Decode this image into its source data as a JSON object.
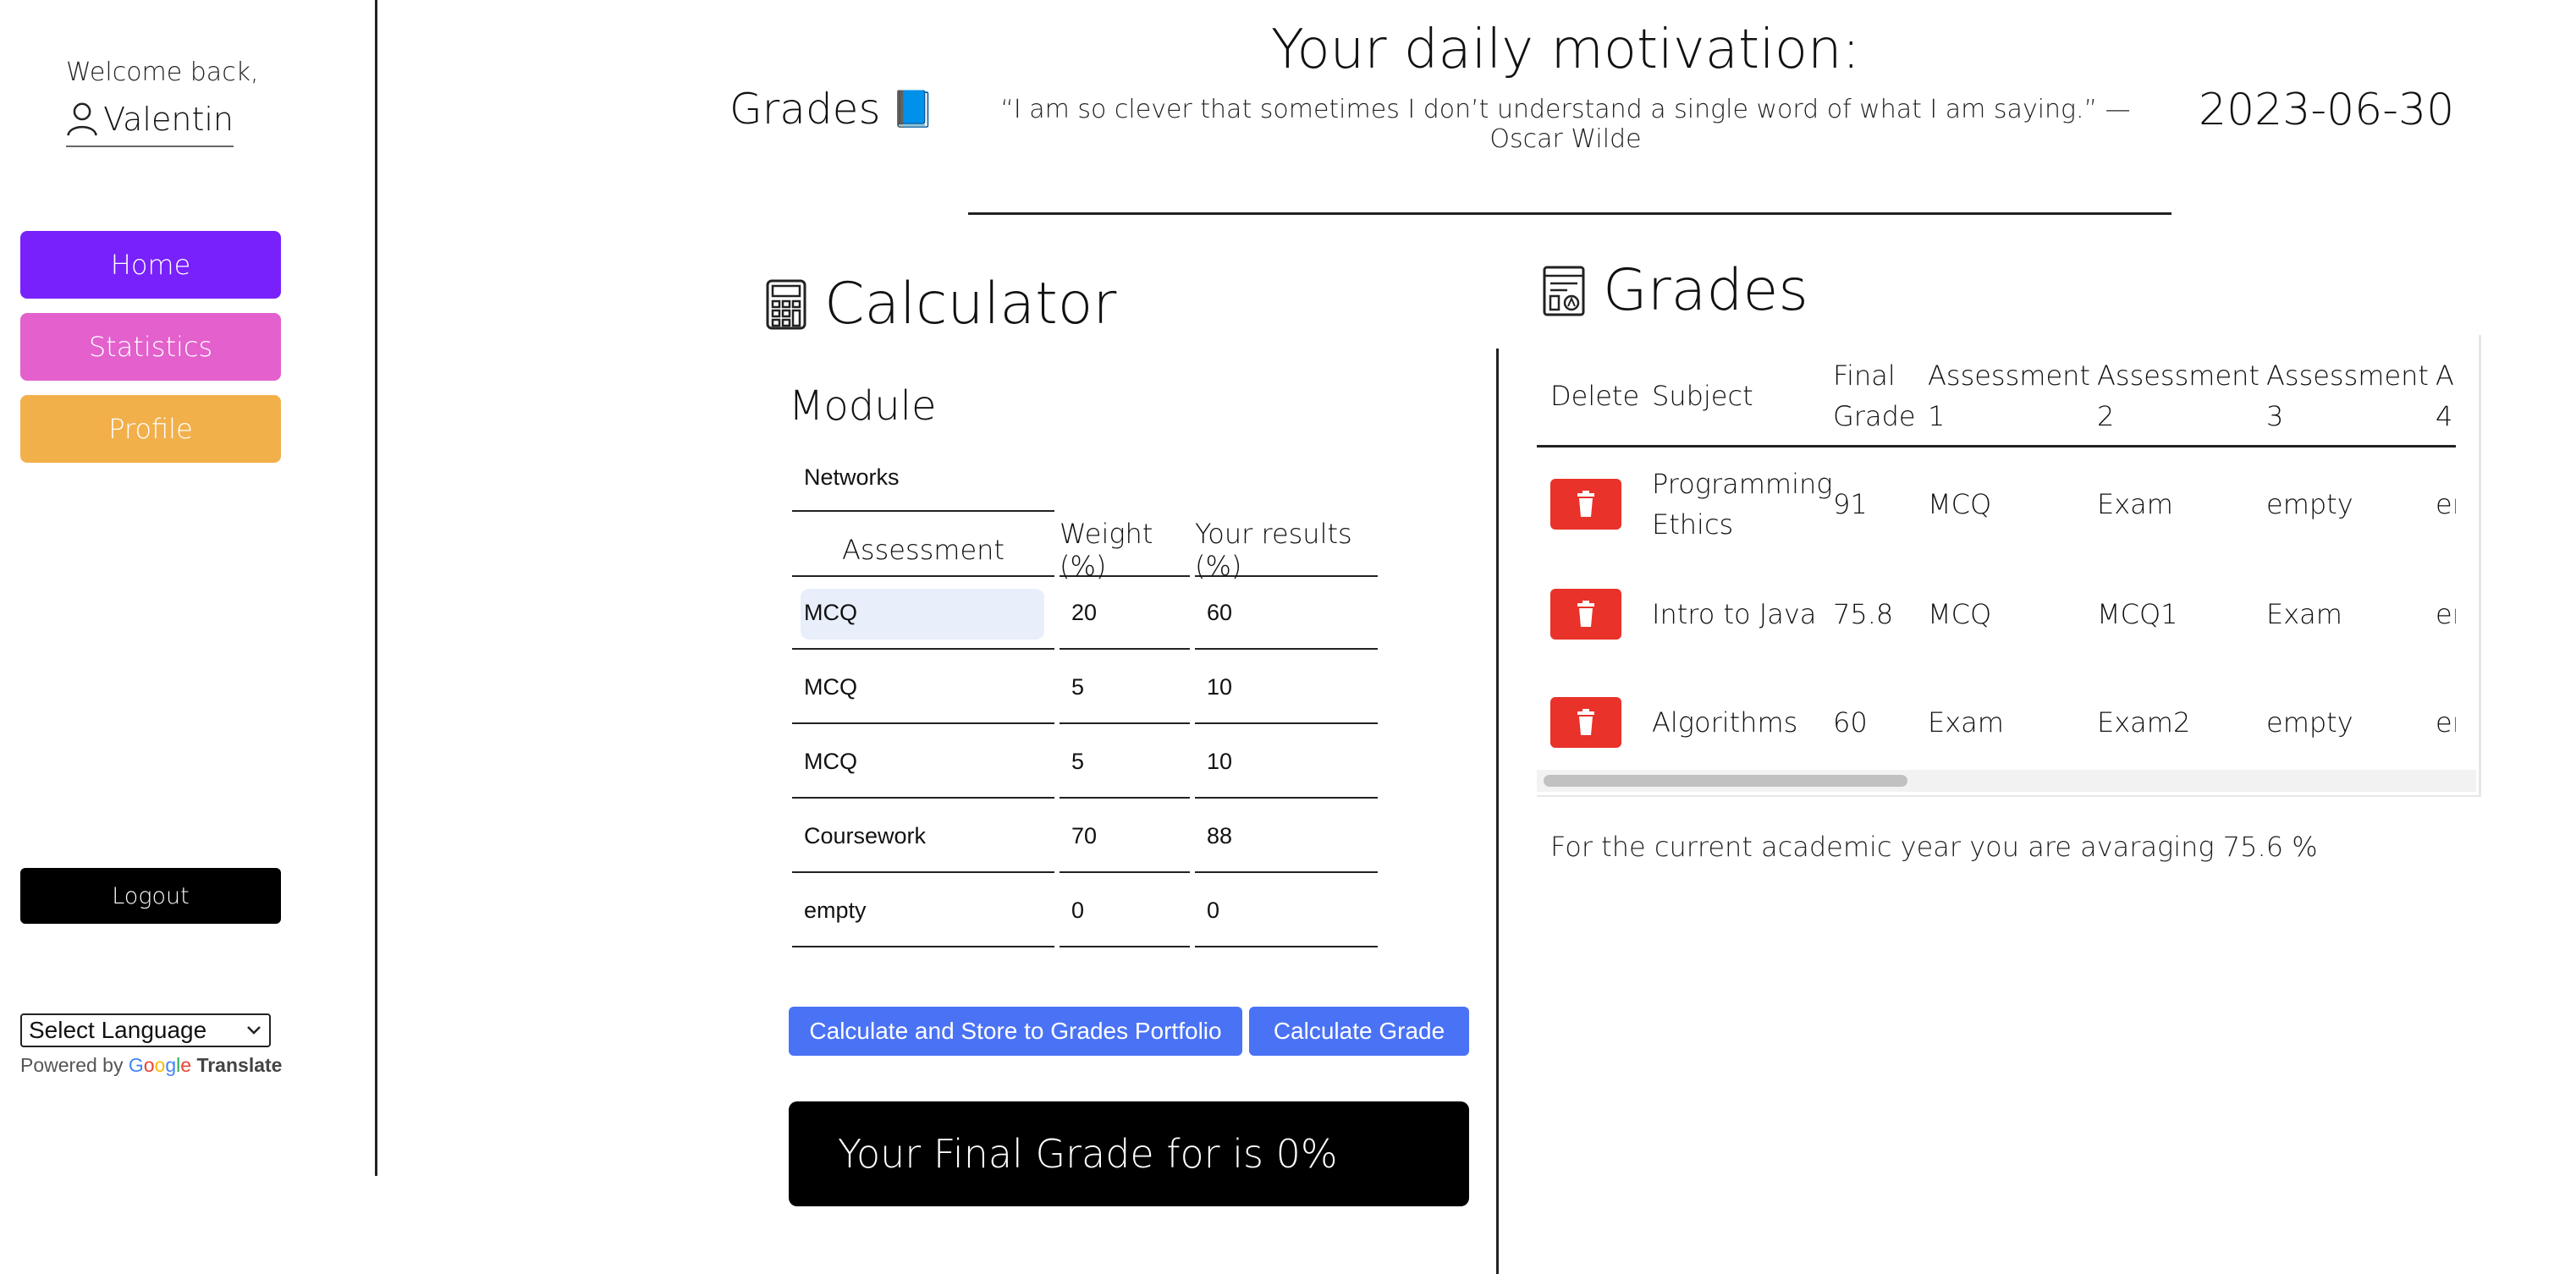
{
  "sidebar": {
    "welcome": "Welcome back,",
    "username": "Valentin",
    "nav": {
      "home": "Home",
      "statistics": "Statistics",
      "profile": "Profile"
    },
    "logout": "Logout",
    "language_select": "Select Language",
    "powered_by": "Powered by",
    "google": [
      "G",
      "o",
      "o",
      "g",
      "l",
      "e"
    ],
    "translate": "Translate"
  },
  "header": {
    "motivation_title": "Your daily motivation:",
    "app_title": "Grades",
    "app_icon": "📘",
    "quote": "“I am so clever that sometimes I don’t understand a single word of what I am saying.” — Oscar Wilde",
    "date": "2023-06-30"
  },
  "calculator": {
    "title": "Calculator",
    "module_label": "Module",
    "module_value": "Networks",
    "headers": {
      "assessment": "Assessment",
      "weight": "Weight (%)",
      "results": "Your results (%)"
    },
    "rows": [
      {
        "assessment": "MCQ",
        "weight": "20",
        "result": "60"
      },
      {
        "assessment": "MCQ",
        "weight": "5",
        "result": "10"
      },
      {
        "assessment": "MCQ",
        "weight": "5",
        "result": "10"
      },
      {
        "assessment": "Coursework",
        "weight": "70",
        "result": "88"
      },
      {
        "assessment": "empty",
        "weight": "0",
        "result": "0"
      }
    ],
    "store_button": "Calculate and Store to Grades Portfolio",
    "calc_button": "Calculate Grade",
    "final_grade": "Your Final Grade for is 0%"
  },
  "grades": {
    "title": "Grades",
    "headers": {
      "delete": "Delete",
      "subject": "Subject",
      "final_1": "Final",
      "final_2": "Grade",
      "a1_1": "Assessment",
      "a1_2": "1",
      "a2_1": "Assessment",
      "a2_2": "2",
      "a3_1": "Assessment",
      "a3_2": "3",
      "a4_1": "As",
      "a4_2": "4"
    },
    "rows": [
      {
        "subject_1": "Programming",
        "subject_2": "Ethics",
        "final": "91",
        "a1": "MCQ",
        "a2": "Exam",
        "a3": "empty",
        "a4": "en"
      },
      {
        "subject_1": "Intro to Java",
        "subject_2": "",
        "final": "75.8",
        "a1": "MCQ",
        "a2": "MCQ1",
        "a3": "Exam",
        "a4": "en"
      },
      {
        "subject_1": "Algorithms",
        "subject_2": "",
        "final": "60",
        "a1": "Exam",
        "a2": "Exam2",
        "a3": "empty",
        "a4": "en"
      }
    ],
    "average_text": "For the current academic year you are avaraging 75.6 %"
  },
  "colors": {
    "home": "#7821fb",
    "statistics": "#e360cd",
    "profile": "#f2b04b",
    "primary_button": "#4a72f4",
    "delete_button": "#e8322a"
  }
}
